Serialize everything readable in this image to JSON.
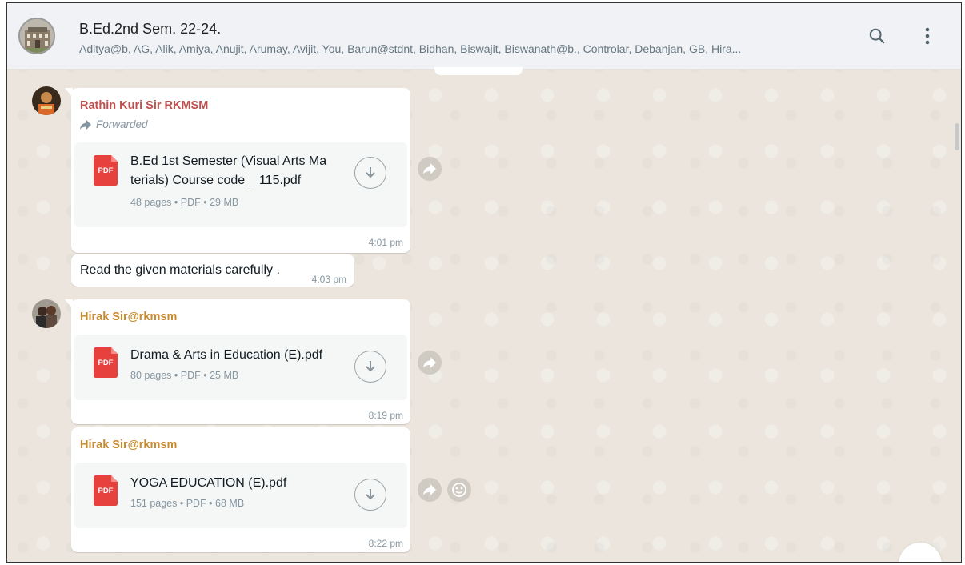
{
  "header": {
    "group_name": "B.Ed.2nd Sem. 22-24.",
    "members": "Aditya@b, AG, Alik, Amiya, Anujit, Arumay, Avijit, You, Barun@stdnt, Bidhan, Biswajit, Biswanath@b., Controlar, Debanjan, GB, Hira...",
    "icons": [
      "search-icon",
      "menu-icon"
    ]
  },
  "messages": [
    {
      "sender": "Rathin Kuri Sir RKMSM",
      "sender_color": "#c0504d",
      "forwarded_label": "Forwarded",
      "doc_name_line1": "B.Ed 1st Semester (Visual Arts Ma",
      "doc_name_line2": "terials) Course code _ 115.pdf",
      "doc_meta": "48 pages • PDF • 29 MB",
      "pdf_label": "PDF",
      "time": "4:01 pm"
    },
    {
      "text": "Read the given materials carefully .",
      "time": "4:03 pm"
    },
    {
      "sender": "Hirak Sir@rkmsm",
      "sender_color": "#c88a2c",
      "doc_name": "Drama & Arts in Education (E).pdf",
      "doc_meta": "80 pages • PDF • 25 MB",
      "pdf_label": "PDF",
      "time": "8:19 pm"
    },
    {
      "sender": "Hirak Sir@rkmsm",
      "sender_color": "#c88a2c",
      "doc_name": "YOGA EDUCATION (E).pdf",
      "doc_meta": "151 pages • PDF • 68 MB",
      "pdf_label": "PDF",
      "time": "8:22 pm"
    }
  ],
  "colors": {
    "pdf_red": "#e6413c",
    "chat_bg": "#ebe5dd",
    "bubble": "#ffffff",
    "doc_bg": "#f5f6f6"
  }
}
